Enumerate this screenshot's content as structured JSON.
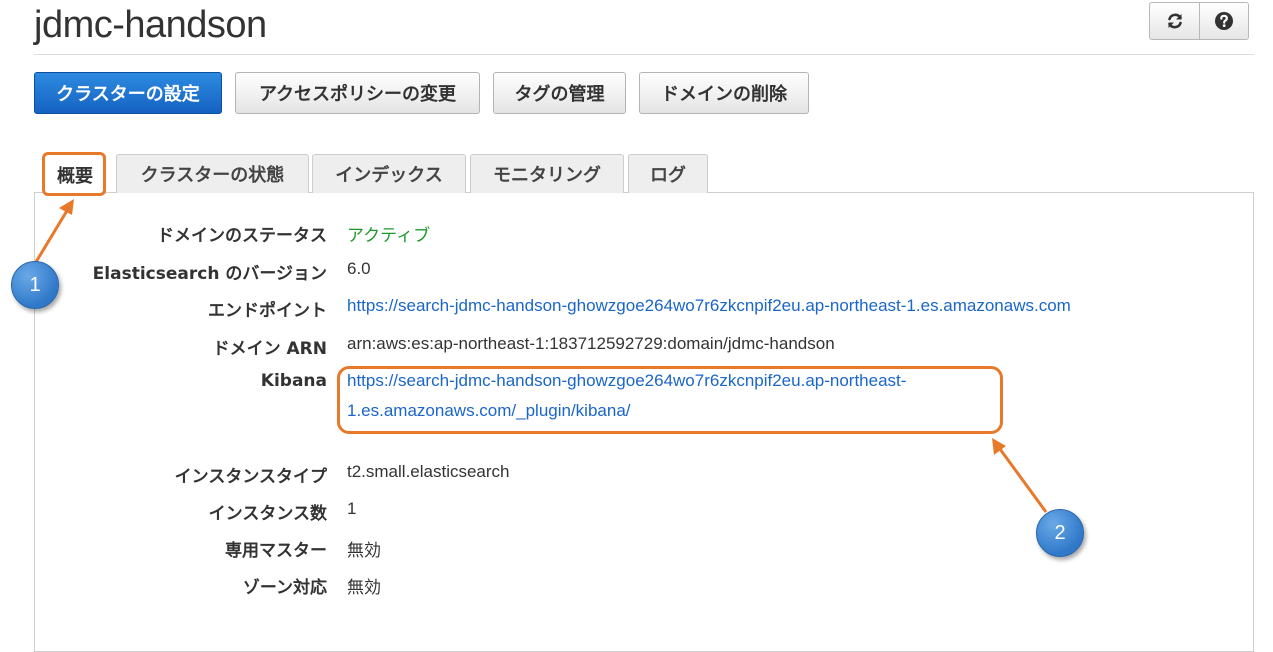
{
  "page": {
    "title": "jdmc-handson"
  },
  "toolbar": {
    "refresh_icon": "refresh-icon",
    "help_icon": "help-icon",
    "buttons": [
      "クラスターの設定",
      "アクセスポリシーの変更",
      "タグの管理",
      "ドメインの削除"
    ]
  },
  "tabs": [
    "概要",
    "クラスターの状態",
    "インデックス",
    "モニタリング",
    "ログ"
  ],
  "details": {
    "domain_status": {
      "label": "ドメインのステータス",
      "value": "アクティブ"
    },
    "es_version": {
      "label": "Elasticsearch のバージョン",
      "value": "6.0"
    },
    "endpoint": {
      "label": "エンドポイント",
      "value": "https://search-jdmc-handson-ghowzgoe264wo7r6zkcnpif2eu.ap-northeast-1.es.amazonaws.com"
    },
    "domain_arn": {
      "label": "ドメイン ARN",
      "value": "arn:aws:es:ap-northeast-1:183712592729:domain/jdmc-handson"
    },
    "kibana": {
      "label": "Kibana",
      "value_line1": "https://search-jdmc-handson-ghowzgoe264wo7r6zkcnpif2eu.ap-northeast-",
      "value_line2": "1.es.amazonaws.com/_plugin/kibana/"
    },
    "instance_type": {
      "label": "インスタンスタイプ",
      "value": "t2.small.elasticsearch"
    },
    "instance_count": {
      "label": "インスタンス数",
      "value": "1"
    },
    "dedicated_master": {
      "label": "専用マスター",
      "value": "無効"
    },
    "zone_awareness": {
      "label": "ゾーン対応",
      "value": "無効"
    }
  },
  "annotations": {
    "badge1": "1",
    "badge2": "2",
    "color": "#e8782a"
  },
  "colors": {
    "primary": "#1a6fd0",
    "link": "#1a66c9",
    "status_active": "#1d9a2b"
  }
}
